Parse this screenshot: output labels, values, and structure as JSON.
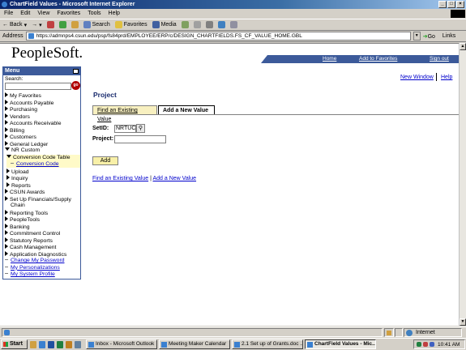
{
  "window": {
    "title": "ChartField Values - Microsoft Internet Explorer"
  },
  "menubar": [
    "File",
    "Edit",
    "View",
    "Favorites",
    "Tools",
    "Help"
  ],
  "toolbar": {
    "back": "Back",
    "search": "Search",
    "favorites": "Favorites",
    "media": "Media"
  },
  "address": {
    "label": "Address",
    "url": "https://admnps4.csun.edu/psp/fs84prd/EMPLOYEE/ERP/c/DESIGN_CHARTFIELDS.FS_CF_VALUE_HOME.GBL",
    "go": "Go",
    "links": "Links"
  },
  "header": {
    "logo": "PeopleSoft.",
    "home": "Home",
    "add_favorites": "Add to Favorites",
    "sign_out": "Sign out"
  },
  "menu": {
    "title": "Menu",
    "search_label": "Search:",
    "go": "go",
    "items": [
      "My Favorites",
      "Accounts Payable",
      "Purchasing",
      "Vendors",
      "Accounts Receivable",
      "Billing",
      "Customers",
      "General Ledger"
    ],
    "nr_custom": "NR Custom",
    "conversion_table": "Conversion Code Table",
    "conversion_code": "Conversion Code",
    "nr_sub": [
      "Upload",
      "Inquiry",
      "Reports"
    ],
    "items2": [
      "CSUN Awards",
      "Set Up Financials/Supply",
      "Chain",
      "Reporting Tools",
      "PeopleTools",
      "Banking",
      "Commitment Control",
      "Statutory Reports",
      "Cash Management",
      "Application Diagnostics"
    ],
    "links": [
      "Change My Password",
      "My Personalizations",
      "My System Profile"
    ]
  },
  "topright": {
    "new_window": "New Window",
    "help": "Help"
  },
  "page": {
    "title": "Project",
    "tab_find": "Find an Existing Value",
    "tab_add": "Add a New Value",
    "setid_label": "SetID:",
    "setid_value": "NRTUC",
    "project_label": "Project:",
    "project_value": "",
    "add_button": "Add",
    "link_find": "Find an Existing Value",
    "link_add": "Add a New Value"
  },
  "status": {
    "zone": "Internet"
  },
  "taskbar": {
    "start": "Start",
    "tasks": [
      "Inbox - Microsoft Outlook",
      "Meeting Maker Calendar",
      "2.1 Set up of Grants.doc ...",
      "ChartField Values - Mic..."
    ],
    "clock": "10:41 AM"
  }
}
